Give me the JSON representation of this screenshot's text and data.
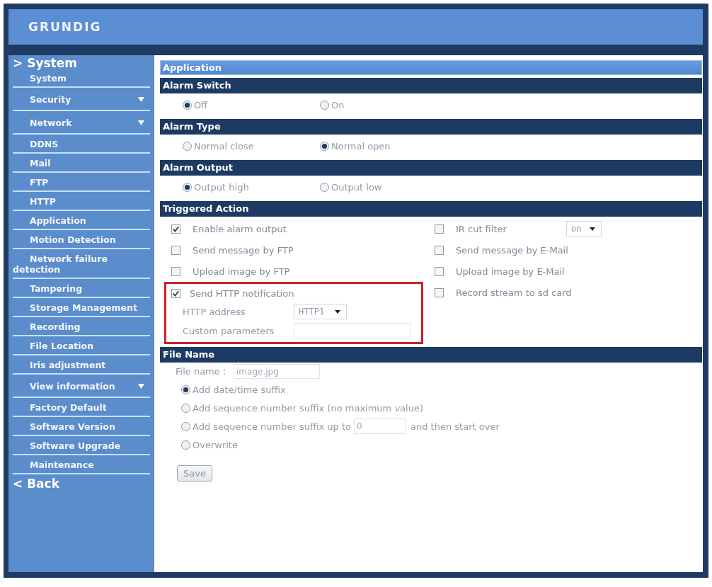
{
  "header": {
    "logo": "GRUNDIG"
  },
  "sidebar": {
    "heading": "> System",
    "items": [
      {
        "label": "System",
        "submenu": false
      },
      {
        "label": "Security",
        "submenu": true
      },
      {
        "label": "Network",
        "submenu": true
      },
      {
        "label": "DDNS",
        "submenu": false
      },
      {
        "label": "Mail",
        "submenu": false
      },
      {
        "label": "FTP",
        "submenu": false
      },
      {
        "label": "HTTP",
        "submenu": false
      },
      {
        "label": "Application",
        "submenu": false
      },
      {
        "label": "Motion Detection",
        "submenu": false
      },
      {
        "label": "Network failure detection",
        "submenu": false
      },
      {
        "label": "Tampering",
        "submenu": false
      },
      {
        "label": "Storage Management",
        "submenu": false
      },
      {
        "label": "Recording",
        "submenu": false
      },
      {
        "label": "File Location",
        "submenu": false
      },
      {
        "label": "Iris adjustment",
        "submenu": false
      },
      {
        "label": "View information",
        "submenu": true
      },
      {
        "label": "Factory Default",
        "submenu": false
      },
      {
        "label": "Software Version",
        "submenu": false
      },
      {
        "label": "Software Upgrade",
        "submenu": false
      },
      {
        "label": "Maintenance",
        "submenu": false
      }
    ],
    "back": "< Back"
  },
  "page": {
    "title": "Application",
    "sections": [
      {
        "kind": "radio",
        "title": "Alarm Switch",
        "options": [
          {
            "label": "Off",
            "selected": true
          },
          {
            "label": "On",
            "selected": false
          }
        ]
      },
      {
        "kind": "radio",
        "title": "Alarm Type",
        "options": [
          {
            "label": "Normal close",
            "selected": false
          },
          {
            "label": "Normal open",
            "selected": true
          }
        ]
      },
      {
        "kind": "radio",
        "title": "Alarm Output",
        "options": [
          {
            "label": "Output high",
            "selected": true
          },
          {
            "label": "Output low",
            "selected": false
          }
        ]
      },
      {
        "kind": "actions",
        "title": "Triggered Action",
        "left": [
          {
            "label": "Enable alarm output",
            "checked": true
          },
          {
            "label": "Send message by FTP",
            "checked": false
          },
          {
            "label": "Upload image by FTP",
            "checked": false
          }
        ],
        "http": {
          "label": "Send HTTP notification",
          "checked": true,
          "highlighted": true,
          "address_label": "HTTP address",
          "address_value": "HTTP1",
          "params_label": "Custom parameters"
        },
        "right": [
          {
            "label": "IR cut filter",
            "checked": false,
            "select": "on"
          },
          {
            "label": "Send message by E-Mail",
            "checked": false
          },
          {
            "label": "Upload image by E-Mail",
            "checked": false
          },
          {
            "label": "Record stream to sd card",
            "checked": false
          }
        ]
      },
      {
        "kind": "filename",
        "title": "File Name",
        "field_label": "File name :",
        "field_value": "image.jpg",
        "options": [
          {
            "kind": "plain",
            "label": "Add date/time suffix",
            "selected": true
          },
          {
            "kind": "plain",
            "label": "Add sequence number suffix (no maximum value)",
            "selected": false
          },
          {
            "kind": "limit",
            "label": "Add sequence number suffix up to",
            "value": "0",
            "after": "and then start over",
            "selected": false
          },
          {
            "kind": "plain",
            "label": "Overwrite",
            "selected": false
          }
        ]
      }
    ],
    "save": "Save"
  }
}
